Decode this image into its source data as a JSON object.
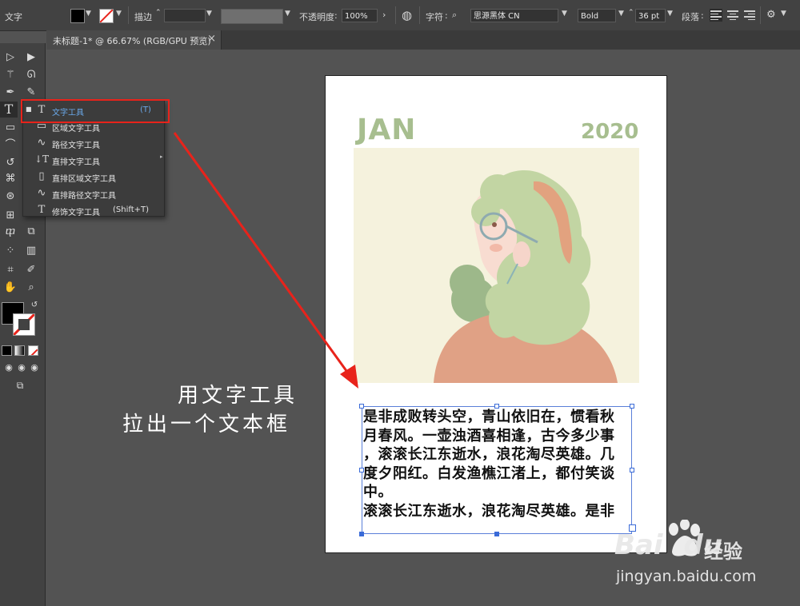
{
  "control_bar": {
    "tool_label": "文字",
    "fill_color": "#000000",
    "stroke_label": "描边",
    "opacity_label": "不透明度",
    "opacity_value": "100%",
    "character_label": "字符",
    "font_family": "思源黑体 CN",
    "font_style": "Bold",
    "font_size": "36 pt",
    "paragraph_label": "段落"
  },
  "document_tab": {
    "title": "未标题-1* @ 66.67% (RGB/GPU 预览)",
    "close_glyph": "×"
  },
  "flyout_menu": {
    "items": [
      {
        "icon": "T",
        "label": "文字工具",
        "shortcut": "(T)"
      },
      {
        "icon": "▭",
        "label": "区域文字工具",
        "shortcut": ""
      },
      {
        "icon": "∿",
        "label": "路径文字工具",
        "shortcut": ""
      },
      {
        "icon": "↓T",
        "label": "直排文字工具",
        "shortcut": ""
      },
      {
        "icon": "▯",
        "label": "直排区域文字工具",
        "shortcut": ""
      },
      {
        "icon": "∿",
        "label": "直排路径文字工具",
        "shortcut": ""
      },
      {
        "icon": "T",
        "label": "修饰文字工具",
        "shortcut": "(Shift+T)"
      }
    ]
  },
  "artboard": {
    "month": "JAN",
    "year": "2020",
    "accent_color": "#a7be8f",
    "body_lines": [
      "是非成败转头空，青山依旧在，惯看秋",
      "月春风。一壶浊酒喜相逢，古今多少事",
      "，滚滚长江东逝水，浪花淘尽英雄。几",
      "度夕阳红。白发渔樵江渚上，都付笑谈",
      "中。",
      "滚滚长江东逝水，浪花淘尽英雄。是非"
    ]
  },
  "annotation": {
    "line1": "用文字工具",
    "line2": "拉出一个文本框",
    "highlight_color": "#e8231b"
  },
  "watermark": {
    "brand": "Bai",
    "brand_suffix": "du",
    "brand_cn": "经验",
    "url": "jingyan.baidu.com"
  }
}
